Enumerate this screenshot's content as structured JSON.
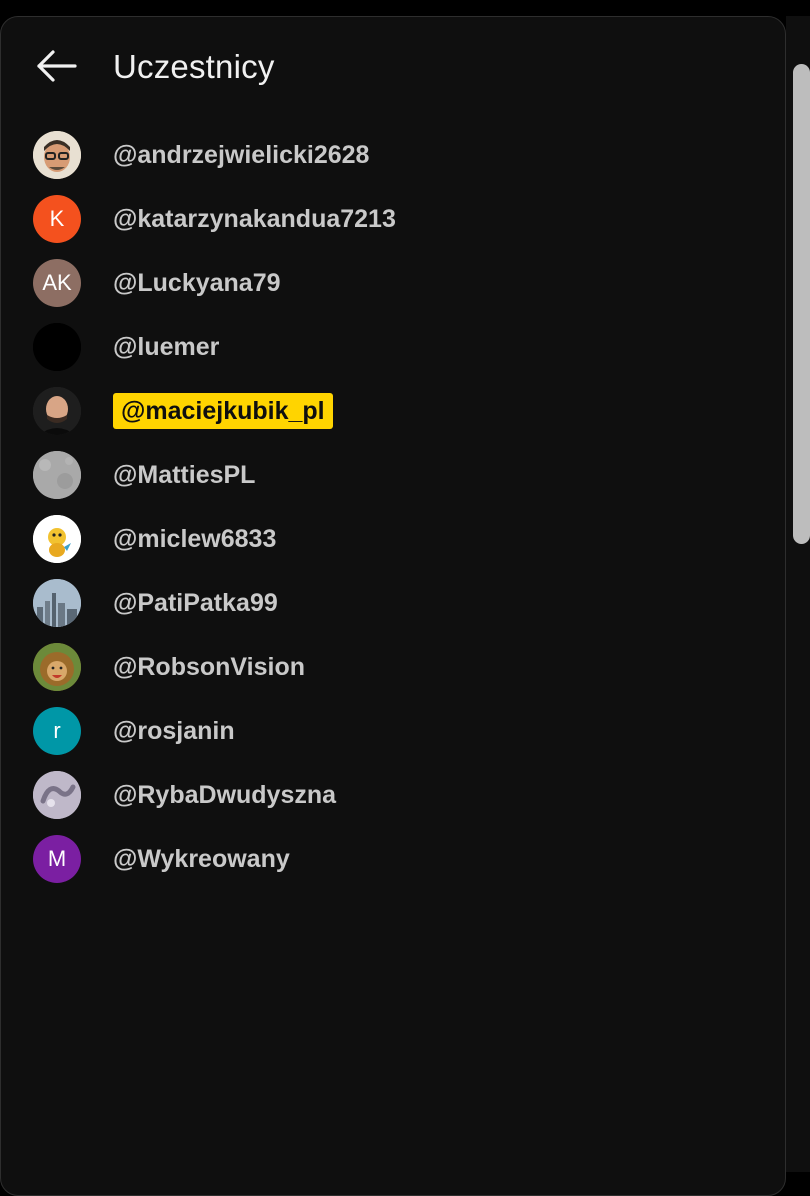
{
  "header": {
    "title": "Uczestnicy",
    "back_icon": "arrow-left-icon"
  },
  "participants": [
    {
      "handle": "@andrzejwielicki2628",
      "avatar_type": "photo",
      "avatar_icon": "person-photo-glasses",
      "bg": "#d9c9b0",
      "highlighted": false
    },
    {
      "handle": "@katarzynakandua7213",
      "avatar_type": "letter",
      "initials": "K",
      "bg": "#f4511e",
      "highlighted": false
    },
    {
      "handle": "@Luckyana79",
      "avatar_type": "letter",
      "initials": "AK",
      "bg": "#8d6e63",
      "highlighted": false
    },
    {
      "handle": "@luemer",
      "avatar_type": "photo",
      "avatar_icon": "black-image",
      "bg": "#000000",
      "highlighted": false
    },
    {
      "handle": "@maciejkubik_pl",
      "avatar_type": "photo",
      "avatar_icon": "person-photo-bald",
      "bg": "#2a2a2a",
      "highlighted": true
    },
    {
      "handle": "@MattiesPL",
      "avatar_type": "photo",
      "avatar_icon": "grey-texture-image",
      "bg": "#a8a8a8",
      "highlighted": false
    },
    {
      "handle": "@miclew6833",
      "avatar_type": "photo",
      "avatar_icon": "yellow-cartoon-image",
      "bg": "#ffffff",
      "highlighted": false
    },
    {
      "handle": "@PatiPatka99",
      "avatar_type": "photo",
      "avatar_icon": "city-skyline-image",
      "bg": "#8fa3b8",
      "highlighted": false
    },
    {
      "handle": "@RobsonVision",
      "avatar_type": "photo",
      "avatar_icon": "lion-image",
      "bg": "#8a6a2a",
      "highlighted": false
    },
    {
      "handle": "@rosjanin",
      "avatar_type": "letter",
      "initials": "r",
      "bg": "#0097a7",
      "highlighted": false
    },
    {
      "handle": "@RybaDwudyszna",
      "avatar_type": "photo",
      "avatar_icon": "abstract-swirl-image",
      "bg": "#b8b0c0",
      "highlighted": false
    },
    {
      "handle": "@Wykreowany",
      "avatar_type": "letter",
      "initials": "M",
      "bg": "#7b1fa2",
      "highlighted": false
    }
  ],
  "colors": {
    "background": "#0f0f0f",
    "text": "#c9c9c9",
    "highlight": "#ffd400"
  }
}
